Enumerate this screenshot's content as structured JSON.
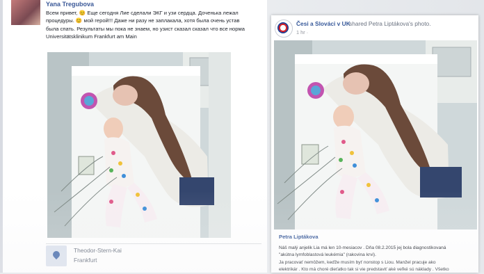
{
  "left_post": {
    "author": "Yana Tregubova",
    "text": "Всем привет, 😊 Еще сегодня Лие сделали ЭКГ и узи сердца. Доченька лежал\nпроцедуры. 😊 мой герой!!! Даже ни разу не заплакала, хотя была очень устав\nбыла спать. Результаты мы пока не знаем, но узист сказал сказал что все норма\nUniversitätsklinikum Frankfurt am Main",
    "location_name": "Theodor-Stern-Kai",
    "location_city": "Frankfurt"
  },
  "right_post": {
    "page_name": "Česi a Slováci v UK",
    "shared_text": "shared Petra Liptákova's photo.",
    "time": "1 hr · ",
    "author": "Petra Liptákova",
    "text": "Náš malý anjelik Lia má len 10-mesiacov . Dňa 08.2.2015 jej bola diagnostikovaná\n\"akútna lymfoblastová leukémia\" (rakovina krvi).\nJa pracovať nemôžem, keďže musím byť nonstop s Liou. Manžel pracuje ako\nelektrikár . Kto má choré dieťatko tak si vie predstaviť aké veľké sú náklady . Všetko"
  },
  "colors": {
    "link": "#365899",
    "text": "#1d2129",
    "meta": "#90949c"
  }
}
